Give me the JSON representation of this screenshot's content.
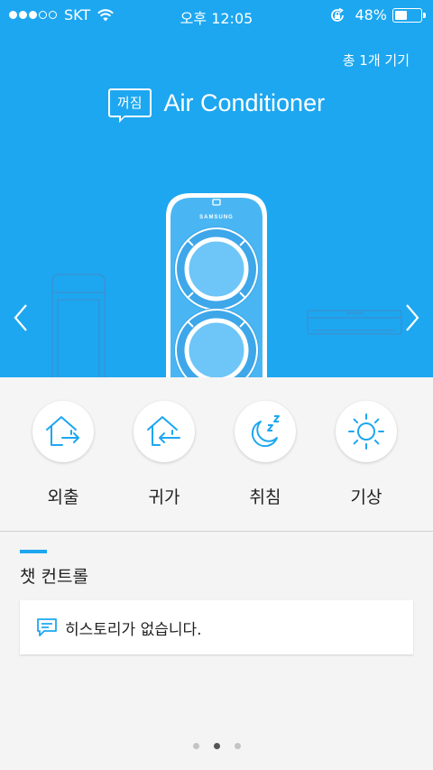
{
  "status_bar": {
    "carrier": "SKT",
    "time": "오후 12:05",
    "battery": "48%",
    "battery_level": 0.48,
    "signal_bars_filled": 3,
    "signal_bars_total": 5
  },
  "header": {
    "device_count": "총 1개 기기",
    "power_state": "꺼짐",
    "device_name": "Air Conditioner"
  },
  "device_brand": "SAMSUNG",
  "modes": [
    {
      "label": "외출",
      "icon": "home-out-icon"
    },
    {
      "label": "귀가",
      "icon": "home-in-icon"
    },
    {
      "label": "취침",
      "icon": "moon-sleep-icon"
    },
    {
      "label": "기상",
      "icon": "sun-icon"
    }
  ],
  "chat": {
    "title": "챗 컨트롤",
    "history_empty": "히스토리가 없습니다."
  },
  "pager": {
    "total": 3,
    "active": 2
  },
  "colors": {
    "accent": "#1da7f0",
    "background": "#f4f4f4"
  }
}
